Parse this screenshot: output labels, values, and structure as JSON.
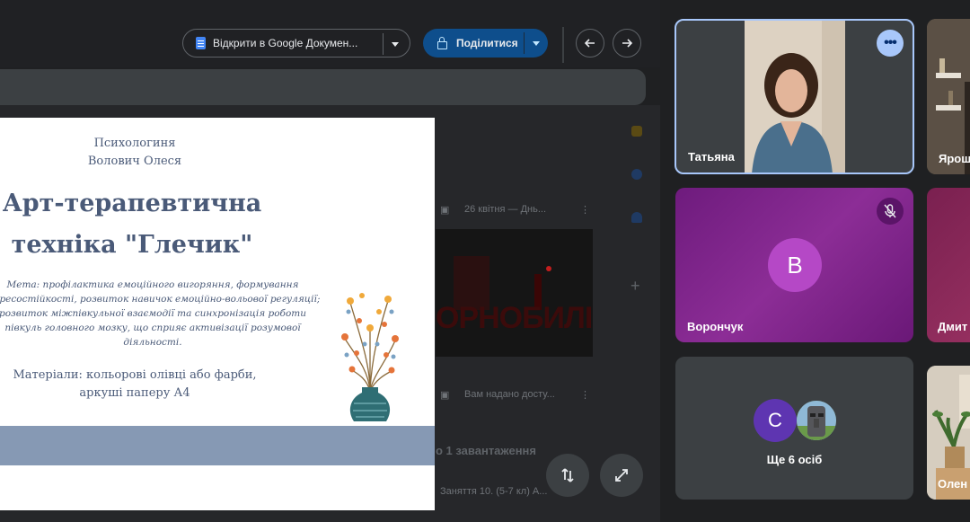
{
  "toolbar": {
    "open_docs_label": "Відкрити в Google Докумен...",
    "share_label": "Поділитися"
  },
  "doc_list": {
    "item1_text": "26 квітня — Днь...",
    "item2_text": "Вам надано досту...",
    "uploads_text": "о 1 завантаження",
    "lesson_text": "Заняття 10. (5-7 кл) А...",
    "video_word": "ОРНОБИЛІ"
  },
  "slide": {
    "author_line1": "Психологиня",
    "author_line2": "Волович Олеся",
    "title_line1": "Арт-терапевтична",
    "title_line2": "техніка \"Глечик\"",
    "goal_line1": "Мета: профілактика емоційного вигоряння, формування",
    "goal_line2": "стресостійкості, розвиток навичок емоційно-вольової регуляції;",
    "goal_line3": "розвиток міжпівкульної взаємодії та синхронізація роботи",
    "goal_line4": "півкуль головного мозку, що сприяє активізації розумової",
    "goal_line5": "діяльності.",
    "materials_line1": "Матеріали: кольорові олівці або фарби,",
    "materials_line2": "аркуші паперу А4"
  },
  "participants": {
    "tatyana": "Татьяна",
    "yarosh": "Ярош",
    "voronchuk": "Ворончук",
    "voronchuk_initial": "В",
    "dmytro": "Дмит",
    "more_initial": "С",
    "more_label": "Ще 6 осіб",
    "olena": "Олен"
  },
  "colors": {
    "accent_blue": "#a8c7fa",
    "share_blue": "#0e4e8c",
    "slide_text": "#4a5a78",
    "slide_band": "#8699b4",
    "purple_tile": "#8c2d96"
  }
}
